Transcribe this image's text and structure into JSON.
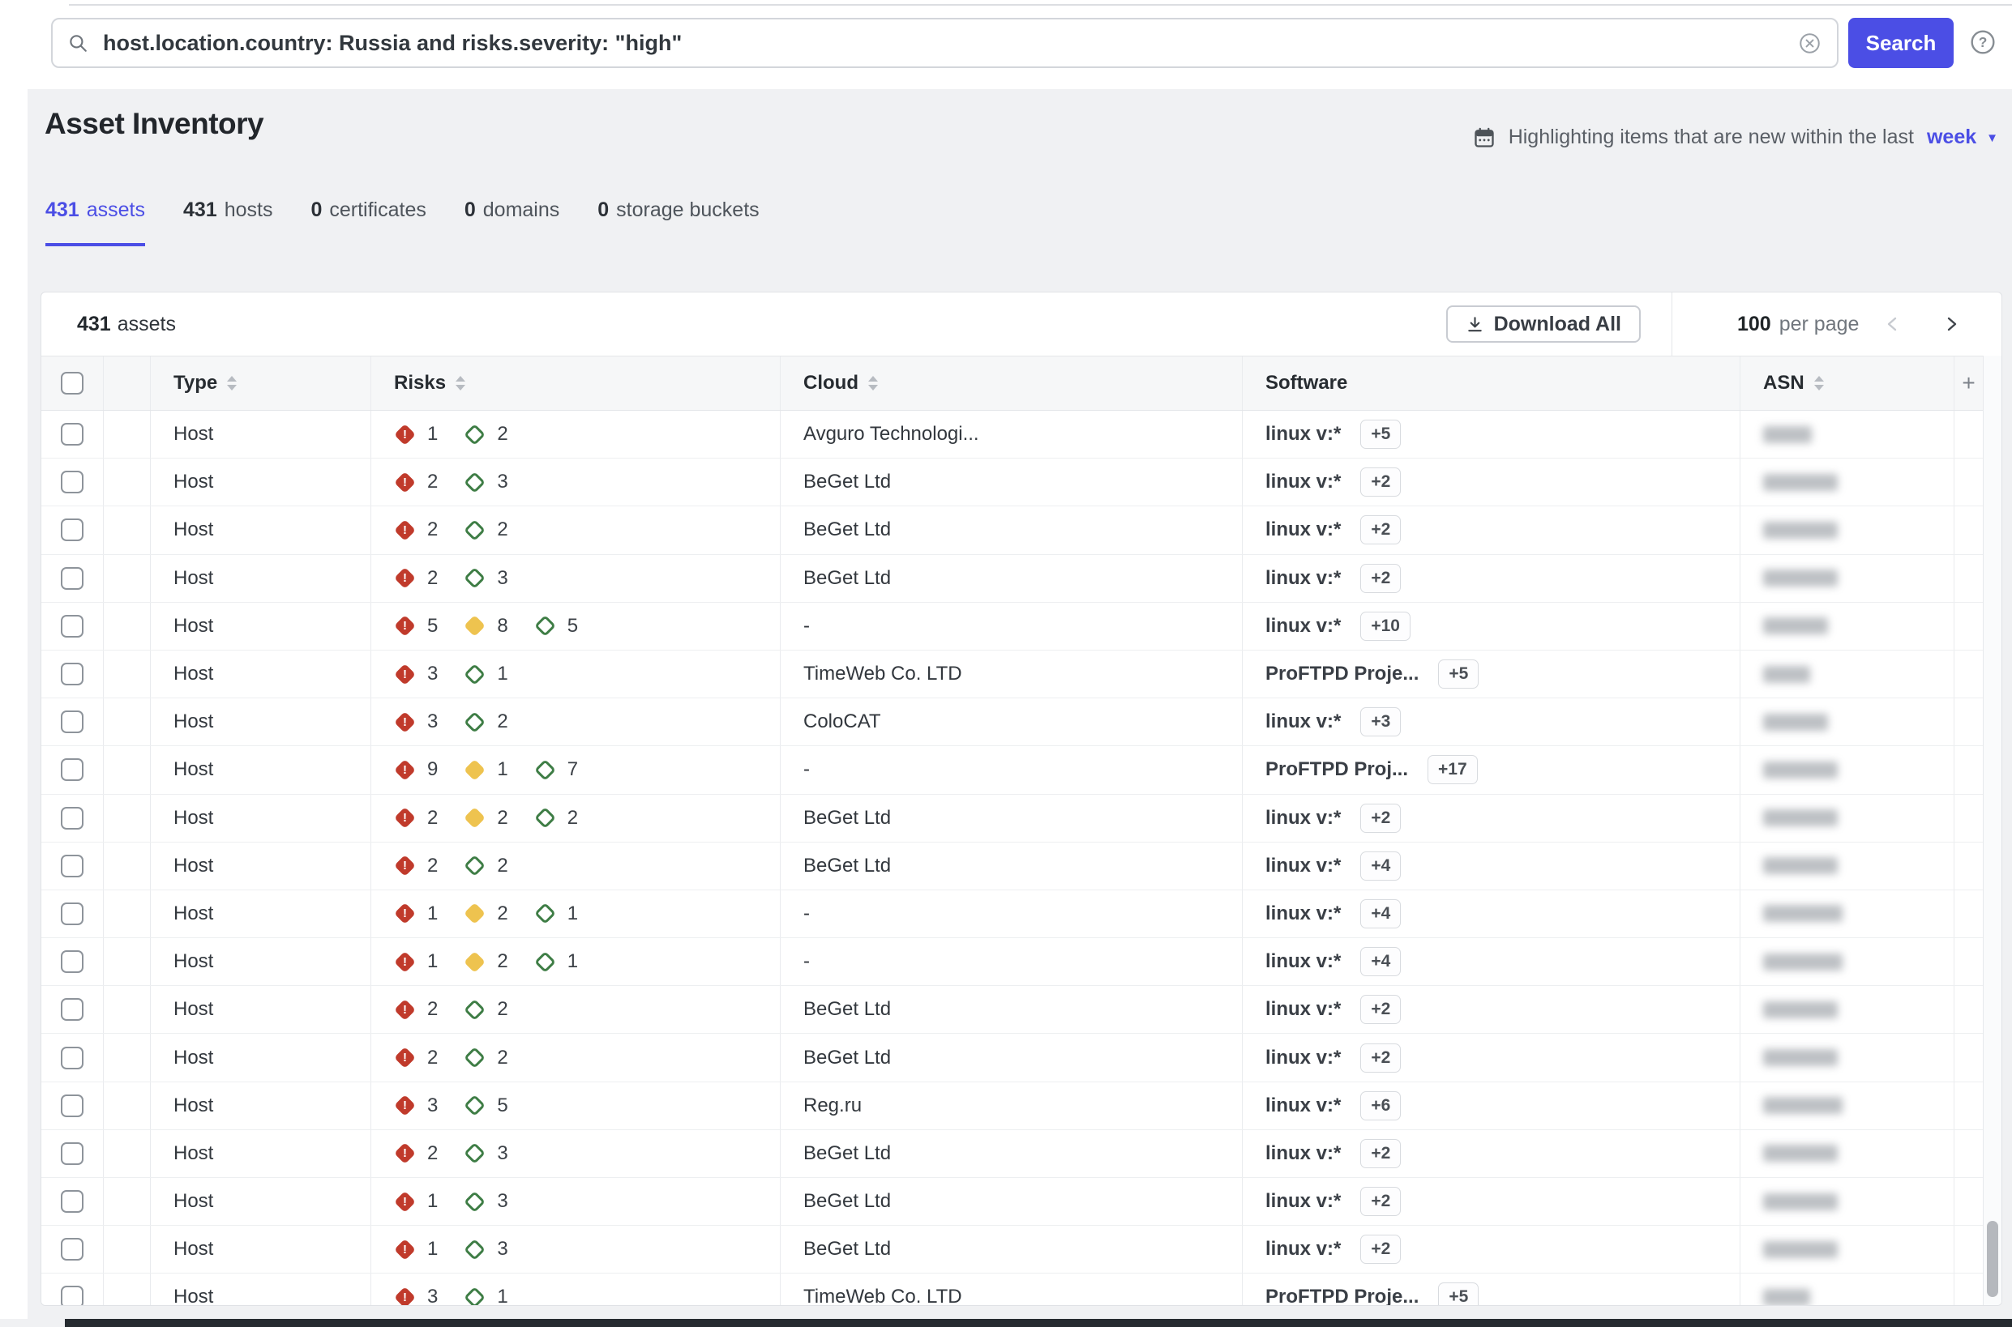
{
  "search": {
    "query": "host.location.country: Russia and risks.severity: \"high\"",
    "search_button": "Search"
  },
  "header": {
    "title": "Asset Inventory",
    "highlight_text": "Highlighting items that are new within the last",
    "highlight_period": "week"
  },
  "tabs": [
    {
      "count": "431",
      "label": "assets",
      "active": true
    },
    {
      "count": "431",
      "label": "hosts",
      "active": false
    },
    {
      "count": "0",
      "label": "certificates",
      "active": false
    },
    {
      "count": "0",
      "label": "domains",
      "active": false
    },
    {
      "count": "0",
      "label": "storage buckets",
      "active": false
    }
  ],
  "table": {
    "summary_count": "431",
    "summary_label": "assets",
    "download_all": "Download All",
    "per_page_value": "100",
    "per_page_label": "per page",
    "add_column_label": "+",
    "columns": [
      {
        "label": "Type",
        "sortable": true
      },
      {
        "label": "Risks",
        "sortable": true
      },
      {
        "label": "Cloud",
        "sortable": true
      },
      {
        "label": "Software",
        "sortable": false
      },
      {
        "label": "ASN",
        "sortable": true
      }
    ],
    "rows": [
      {
        "type": "Host",
        "risks": [
          {
            "severity": "high",
            "count": 1
          },
          {
            "severity": "low",
            "count": 2
          }
        ],
        "cloud": "Avguro Technologi...",
        "software": "linux v:*",
        "software_more": "+5",
        "asn_redacted": true,
        "asn_blur_width": 60
      },
      {
        "type": "Host",
        "risks": [
          {
            "severity": "high",
            "count": 2
          },
          {
            "severity": "low",
            "count": 3
          }
        ],
        "cloud": "BeGet Ltd",
        "software": "linux v:*",
        "software_more": "+2",
        "asn_redacted": true,
        "asn_blur_width": 92
      },
      {
        "type": "Host",
        "risks": [
          {
            "severity": "high",
            "count": 2
          },
          {
            "severity": "low",
            "count": 2
          }
        ],
        "cloud": "BeGet Ltd",
        "software": "linux v:*",
        "software_more": "+2",
        "asn_redacted": true,
        "asn_blur_width": 92
      },
      {
        "type": "Host",
        "risks": [
          {
            "severity": "high",
            "count": 2
          },
          {
            "severity": "low",
            "count": 3
          }
        ],
        "cloud": "BeGet Ltd",
        "software": "linux v:*",
        "software_more": "+2",
        "asn_redacted": true,
        "asn_blur_width": 92
      },
      {
        "type": "Host",
        "risks": [
          {
            "severity": "high",
            "count": 5
          },
          {
            "severity": "medium",
            "count": 8
          },
          {
            "severity": "low",
            "count": 5
          }
        ],
        "cloud": "-",
        "software": "linux v:*",
        "software_more": "+10",
        "asn_redacted": true,
        "asn_blur_width": 80
      },
      {
        "type": "Host",
        "risks": [
          {
            "severity": "high",
            "count": 3
          },
          {
            "severity": "low",
            "count": 1
          }
        ],
        "cloud": "TimeWeb Co. LTD",
        "software": "ProFTPD Proje...",
        "software_more": "+5",
        "asn_redacted": true,
        "asn_blur_width": 58
      },
      {
        "type": "Host",
        "risks": [
          {
            "severity": "high",
            "count": 3
          },
          {
            "severity": "low",
            "count": 2
          }
        ],
        "cloud": "ColoCAT",
        "software": "linux v:*",
        "software_more": "+3",
        "asn_redacted": true,
        "asn_blur_width": 80
      },
      {
        "type": "Host",
        "risks": [
          {
            "severity": "high",
            "count": 9
          },
          {
            "severity": "medium",
            "count": 1
          },
          {
            "severity": "low",
            "count": 7
          }
        ],
        "cloud": "-",
        "software": "ProFTPD Proj...",
        "software_more": "+17",
        "asn_redacted": true,
        "asn_blur_width": 92
      },
      {
        "type": "Host",
        "risks": [
          {
            "severity": "high",
            "count": 2
          },
          {
            "severity": "medium",
            "count": 2
          },
          {
            "severity": "low",
            "count": 2
          }
        ],
        "cloud": "BeGet Ltd",
        "software": "linux v:*",
        "software_more": "+2",
        "asn_redacted": true,
        "asn_blur_width": 92
      },
      {
        "type": "Host",
        "risks": [
          {
            "severity": "high",
            "count": 2
          },
          {
            "severity": "low",
            "count": 2
          }
        ],
        "cloud": "BeGet Ltd",
        "software": "linux v:*",
        "software_more": "+4",
        "asn_redacted": true,
        "asn_blur_width": 92
      },
      {
        "type": "Host",
        "risks": [
          {
            "severity": "high",
            "count": 1
          },
          {
            "severity": "medium",
            "count": 2
          },
          {
            "severity": "low",
            "count": 1
          }
        ],
        "cloud": "-",
        "software": "linux v:*",
        "software_more": "+4",
        "asn_redacted": true,
        "asn_blur_width": 98
      },
      {
        "type": "Host",
        "risks": [
          {
            "severity": "high",
            "count": 1
          },
          {
            "severity": "medium",
            "count": 2
          },
          {
            "severity": "low",
            "count": 1
          }
        ],
        "cloud": "-",
        "software": "linux v:*",
        "software_more": "+4",
        "asn_redacted": true,
        "asn_blur_width": 98
      },
      {
        "type": "Host",
        "risks": [
          {
            "severity": "high",
            "count": 2
          },
          {
            "severity": "low",
            "count": 2
          }
        ],
        "cloud": "BeGet Ltd",
        "software": "linux v:*",
        "software_more": "+2",
        "asn_redacted": true,
        "asn_blur_width": 92
      },
      {
        "type": "Host",
        "risks": [
          {
            "severity": "high",
            "count": 2
          },
          {
            "severity": "low",
            "count": 2
          }
        ],
        "cloud": "BeGet Ltd",
        "software": "linux v:*",
        "software_more": "+2",
        "asn_redacted": true,
        "asn_blur_width": 92
      },
      {
        "type": "Host",
        "risks": [
          {
            "severity": "high",
            "count": 3
          },
          {
            "severity": "low",
            "count": 5
          }
        ],
        "cloud": "Reg.ru",
        "software": "linux v:*",
        "software_more": "+6",
        "asn_redacted": true,
        "asn_blur_width": 98
      },
      {
        "type": "Host",
        "risks": [
          {
            "severity": "high",
            "count": 2
          },
          {
            "severity": "low",
            "count": 3
          }
        ],
        "cloud": "BeGet Ltd",
        "software": "linux v:*",
        "software_more": "+2",
        "asn_redacted": true,
        "asn_blur_width": 92
      },
      {
        "type": "Host",
        "risks": [
          {
            "severity": "high",
            "count": 1
          },
          {
            "severity": "low",
            "count": 3
          }
        ],
        "cloud": "BeGet Ltd",
        "software": "linux v:*",
        "software_more": "+2",
        "asn_redacted": true,
        "asn_blur_width": 92
      },
      {
        "type": "Host",
        "risks": [
          {
            "severity": "high",
            "count": 1
          },
          {
            "severity": "low",
            "count": 3
          }
        ],
        "cloud": "BeGet Ltd",
        "software": "linux v:*",
        "software_more": "+2",
        "asn_redacted": true,
        "asn_blur_width": 92
      },
      {
        "type": "Host",
        "risks": [
          {
            "severity": "high",
            "count": 3
          },
          {
            "severity": "low",
            "count": 1
          }
        ],
        "cloud": "TimeWeb Co. LTD",
        "software": "ProFTPD Proje...",
        "software_more": "+5",
        "asn_redacted": true,
        "asn_blur_width": 58
      }
    ]
  },
  "colors": {
    "accent": "#4b4ee5",
    "risk_high": "#c03a2b",
    "risk_medium": "#eec34f",
    "risk_low": "#3e7d45",
    "page_background": "#f0f1f3",
    "table_header_background": "#f6f7f8"
  }
}
